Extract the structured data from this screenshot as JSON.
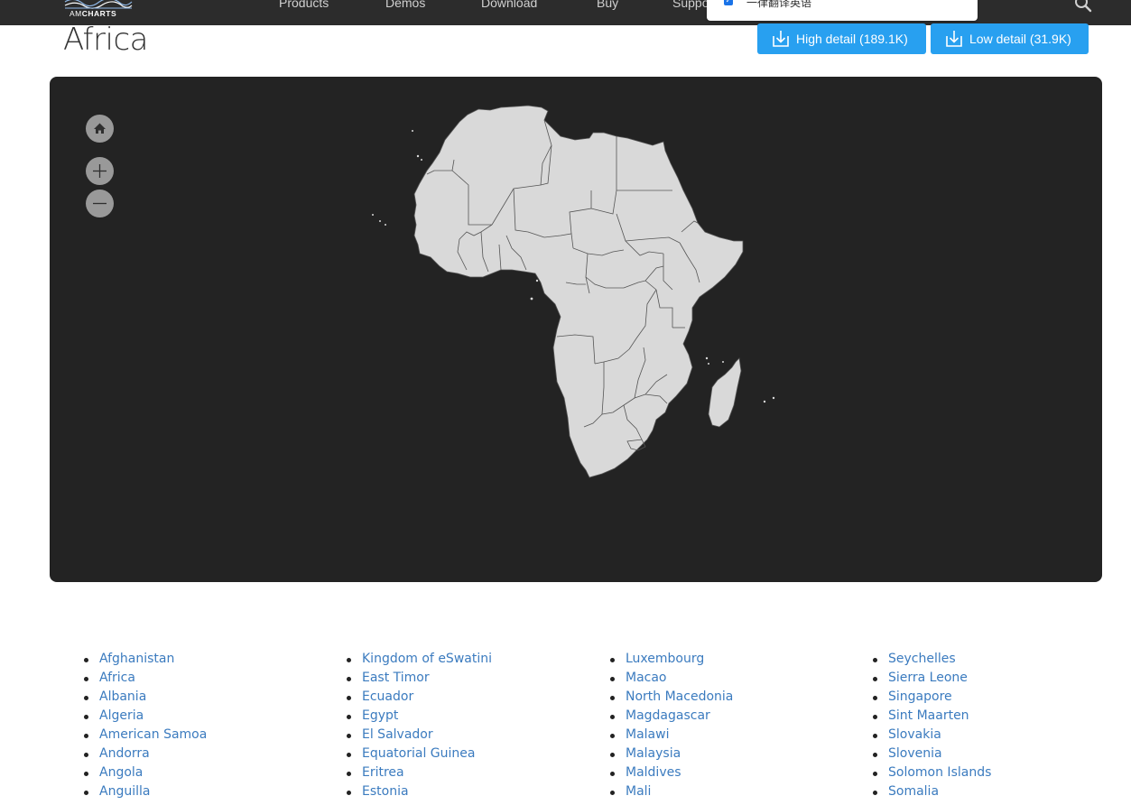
{
  "nav": {
    "logo_prefix": "AM",
    "logo_suffix": "CHARTS",
    "items": [
      "Products",
      "Demos",
      "Download",
      "Buy",
      "Suppo"
    ]
  },
  "popup": {
    "text": "一律翻译英语"
  },
  "page": {
    "title": "Africa",
    "download_high": "High detail (189.1K)",
    "download_low": "Low detail (31.9K)"
  },
  "map": {
    "controls": [
      "home-icon",
      "zoom-in-icon",
      "zoom-out-icon"
    ],
    "background": "#232323",
    "land_color": "#d9d9d9"
  },
  "countries": {
    "col1": [
      "Afghanistan",
      "Africa",
      "Albania",
      "Algeria",
      "American Samoa",
      "Andorra",
      "Angola",
      "Anguilla"
    ],
    "col2": [
      "Kingdom of eSwatini",
      "East Timor",
      "Ecuador",
      "Egypt",
      "El Salvador",
      "Equatorial Guinea",
      "Eritrea",
      "Estonia"
    ],
    "col3": [
      "Luxembourg",
      "Macao",
      "North Macedonia",
      "Magdagascar",
      "Malawi",
      "Malaysia",
      "Maldives",
      "Mali"
    ],
    "col4": [
      "Seychelles",
      "Sierra Leone",
      "Singapore",
      "Sint Maarten",
      "Slovakia",
      "Slovenia",
      "Solomon Islands",
      "Somalia"
    ]
  },
  "colors": {
    "nav_bg": "#2c2c2c",
    "button_blue": "#28a0f0",
    "link_blue": "#3b7bbf"
  }
}
